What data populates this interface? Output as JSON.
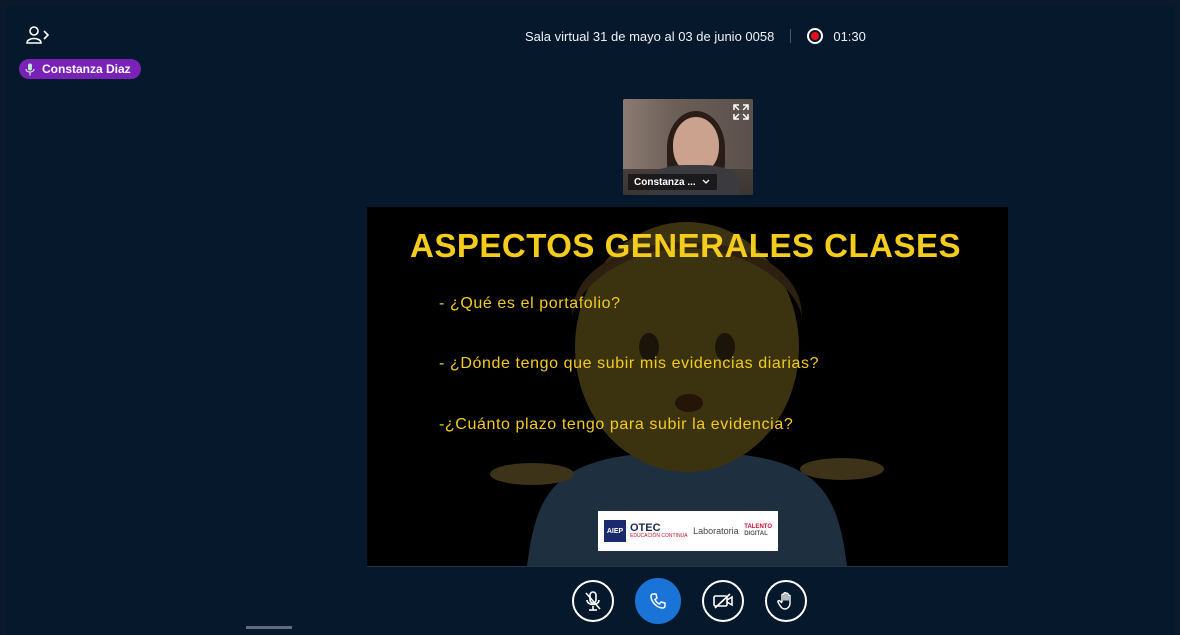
{
  "header": {
    "meeting_title": "Sala virtual 31 de mayo al 03 de junio 0058",
    "recording_time": "01:30"
  },
  "speaker_badge": {
    "name": "Constanza Diaz"
  },
  "webcam": {
    "name": "Constanza ..."
  },
  "slide": {
    "title": "ASPECTOS GENERALES CLASES",
    "bullets": [
      "- ¿Qué es el portafolio?",
      "- ¿Dónde tengo que subir mis evidencias diarias?",
      "-¿Cuánto plazo tengo para subir la evidencia?"
    ],
    "logos": {
      "aiep": "AIEP",
      "otec": "OTEC",
      "otec_sub": "EDUCACIÓN CONTINUA",
      "laboratoria": "Laboratoria",
      "talento_line1": "TALENTO",
      "talento_line2": "DIGITAL"
    }
  },
  "colors": {
    "background": "#06182b",
    "slide_text": "#f4cc1c",
    "badge": "#7a22b8",
    "primary_button": "#1a73d6",
    "record": "#e8101a"
  },
  "controls": [
    {
      "name": "mic-muted-icon"
    },
    {
      "name": "phone-icon"
    },
    {
      "name": "camera-off-icon"
    },
    {
      "name": "raise-hand-icon"
    }
  ]
}
